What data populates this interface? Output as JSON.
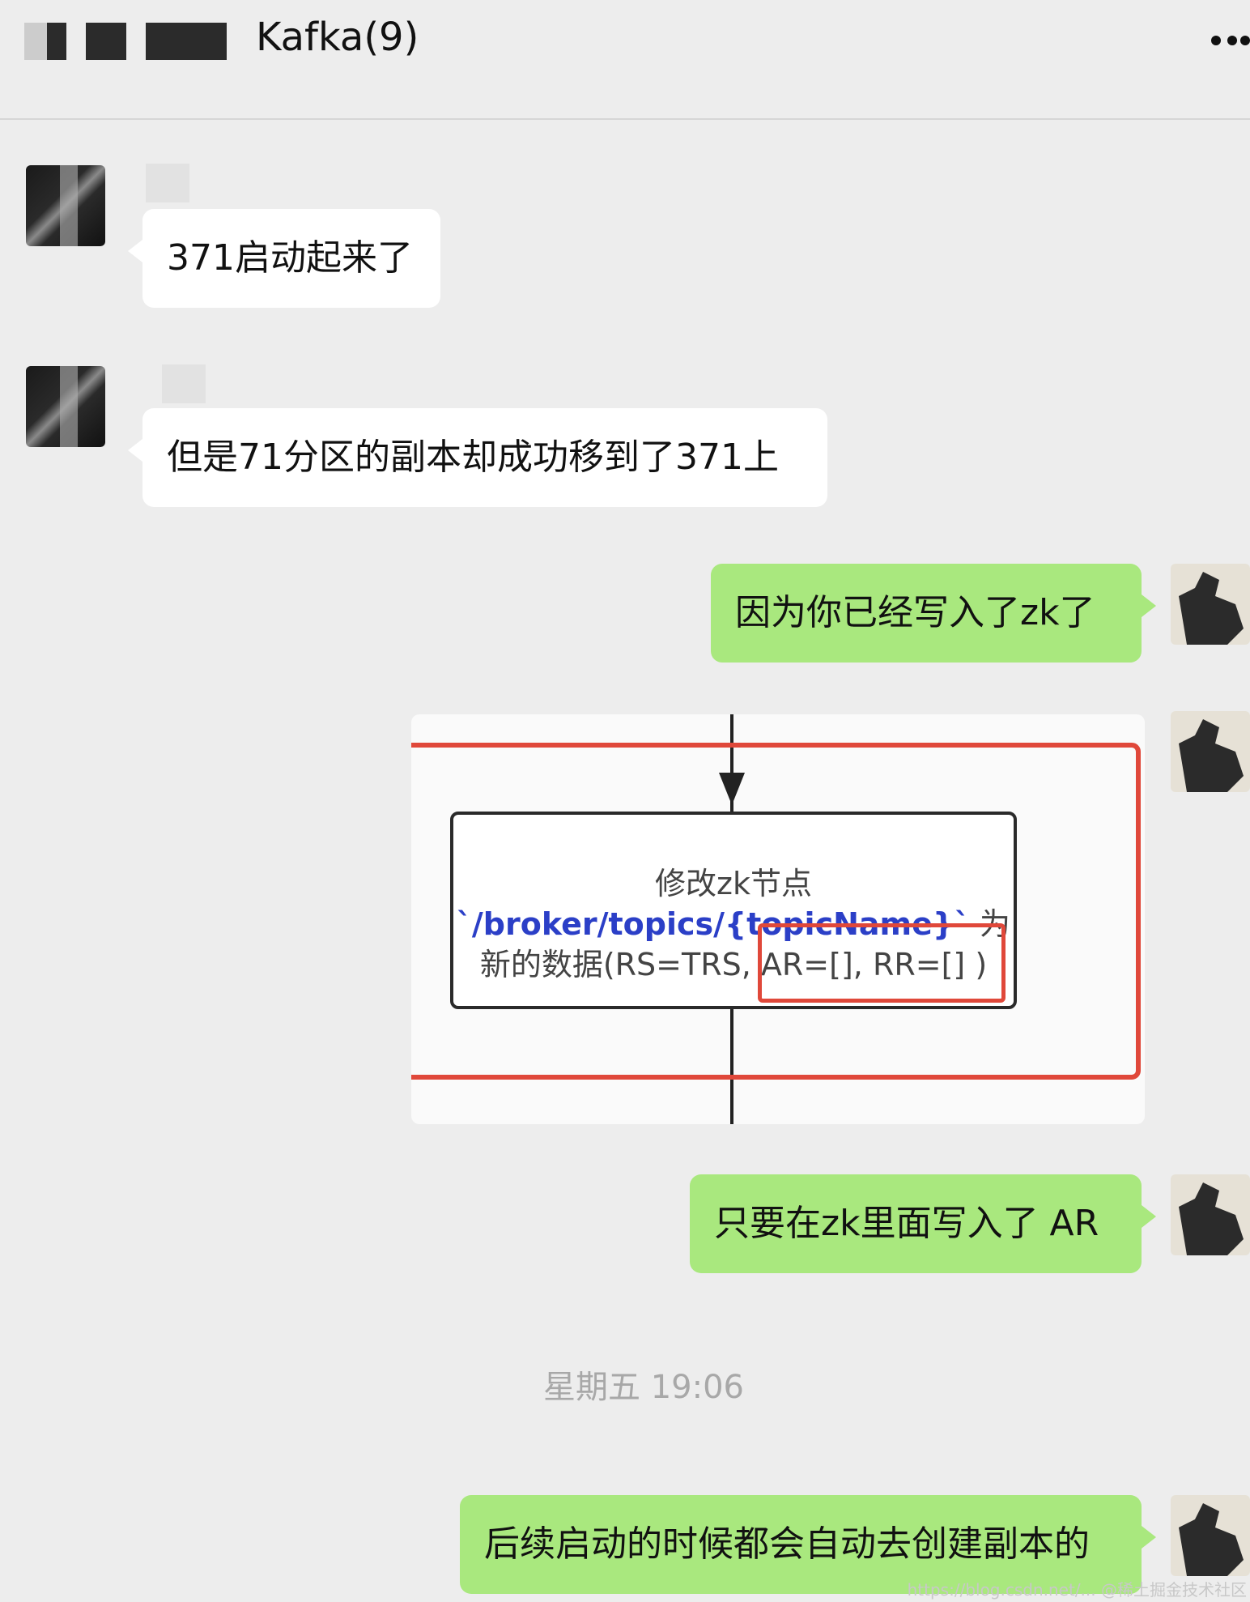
{
  "header": {
    "title": "Kafka(9)",
    "more_icon": "more-dots-icon"
  },
  "messages": [
    {
      "side": "in",
      "text": "371启动起来了"
    },
    {
      "side": "in",
      "text": "但是71分区的副本却成功移到了371上"
    },
    {
      "side": "out",
      "text": "因为你已经写入了zk了"
    },
    {
      "side": "out",
      "type": "image",
      "image": {
        "line1": "修改zk节点",
        "line2_path": "`/broker/topics/{topicName}`",
        "line2_suffix": " 为",
        "line3": "新的数据(RS=TRS, AR=[], RR=[] )",
        "highlight_color": "#e0483a"
      }
    },
    {
      "side": "out",
      "text": "只要在zk里面写入了 AR"
    },
    {
      "side": "out",
      "text": "后续启动的时候都会自动去创建副本的"
    }
  ],
  "timestamp": "星期五 19:06",
  "watermark": "https://blog.csdn.net/... @稀土掘金技术社区",
  "colors": {
    "background": "#ededed",
    "bubble_in": "#ffffff",
    "bubble_out": "#a9e87e"
  }
}
